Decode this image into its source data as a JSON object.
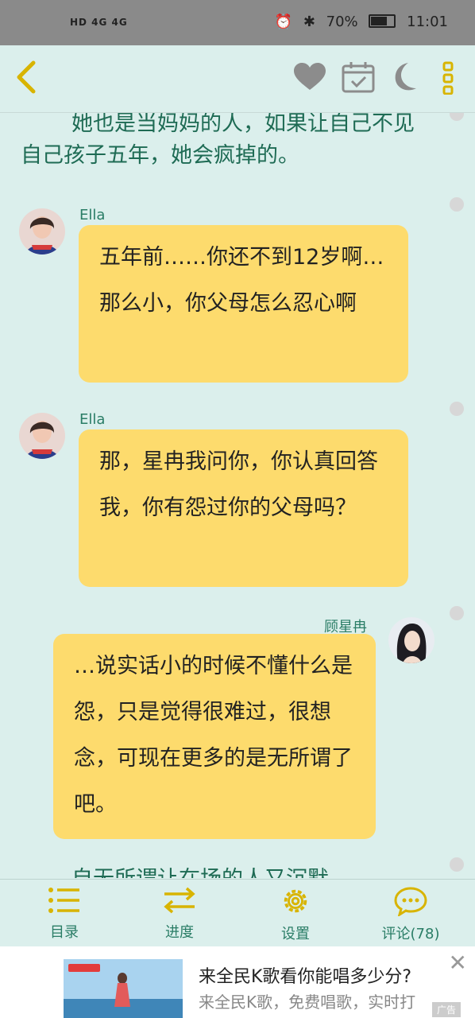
{
  "status": {
    "left_text": "HD 4G 4G",
    "battery": "70%",
    "time": "11:01"
  },
  "topbar": {
    "icons": [
      "back-icon",
      "heart-icon",
      "calendar-icon",
      "moon-icon",
      "more-icon"
    ]
  },
  "content": {
    "narration_top": "她也是当妈妈的人，如果让自己不见自己孩子五年，她会疯掉的。",
    "narration_bottom": "自无所谓让在场的人又沉默",
    "messages": [
      {
        "sender": "Ella",
        "side": "left",
        "text": "五年前……你还不到12岁啊…那么小，你父母怎么忍心啊"
      },
      {
        "sender": "Ella",
        "side": "left",
        "text": "那，星冉我问你，你认真回答我，你有怨过你的父母吗？"
      },
      {
        "sender": "顾星冉",
        "side": "right",
        "text": "…说实话小的时候不懂什么是怨，只是觉得很难过，很想念，可现在更多的是无所谓了吧。"
      }
    ]
  },
  "bottomnav": {
    "items": [
      {
        "label": "目录",
        "icon": "list-icon"
      },
      {
        "label": "进度",
        "icon": "arrows-icon"
      },
      {
        "label": "设置",
        "icon": "gear-icon"
      },
      {
        "label": "评论(78)",
        "icon": "comment-icon"
      }
    ]
  },
  "ad": {
    "title": "来全民K歌看你能唱多少分?",
    "desc": "来全民K歌，免费唱歌，实时打",
    "badge": "广告"
  },
  "colors": {
    "background": "#dbefec",
    "bubble": "#fddb6d",
    "narration": "#1e6b54",
    "accent": "#2a7d66"
  }
}
